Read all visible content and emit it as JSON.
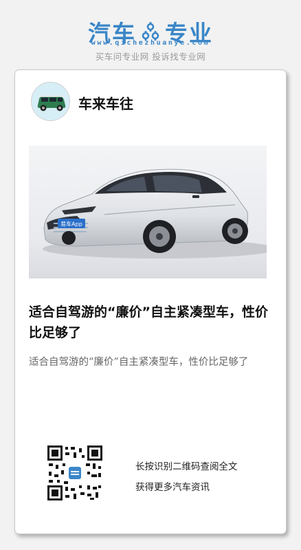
{
  "header": {
    "logo_left": "汽车",
    "logo_right": "专业",
    "logo_url": "www.qichezhuanye.com",
    "tagline": "买车问专业网 投诉找专业网",
    "brand_color": "#3a86c8"
  },
  "card": {
    "author": {
      "name": "车来车往",
      "avatar_icon": "green-car-avatar"
    },
    "hero_image": {
      "icon": "white-sedan-photo",
      "plate_text": "易车App"
    },
    "article": {
      "title": "适合自驾游的“廉价”自主紧凑型车，性价比足够了",
      "summary": "适合自驾游的“廉价”自主紧凑型车，性价比足够了"
    },
    "qr": {
      "line1": "长按识别二维码查阅全文",
      "line2": "获得更多汽车资讯"
    }
  }
}
